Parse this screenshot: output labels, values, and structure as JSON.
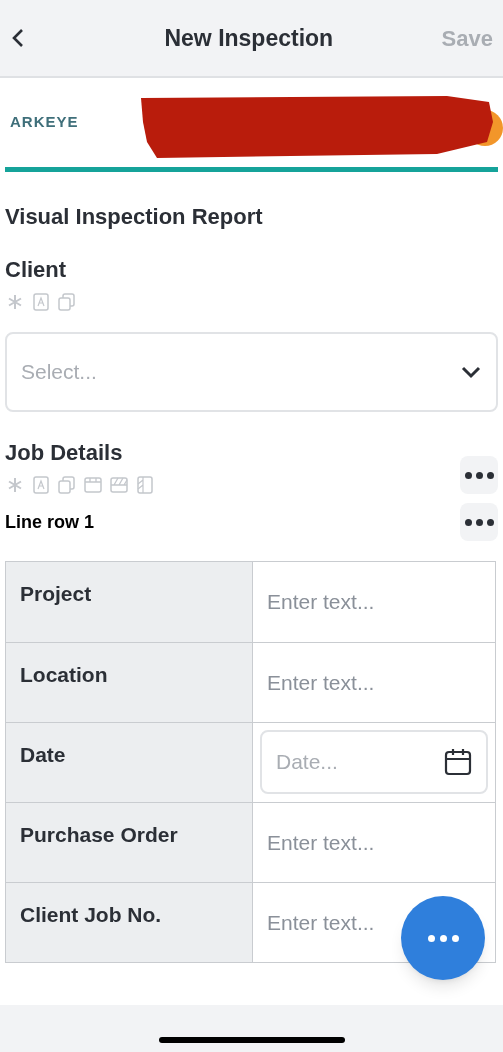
{
  "header": {
    "title": "New Inspection",
    "save": "Save",
    "save_disabled": true
  },
  "logo": {
    "text": "ARKEYE"
  },
  "form_title": "Visual Inspection Report",
  "client": {
    "label": "Client",
    "placeholder": "Select..."
  },
  "job_details": {
    "label": "Job Details",
    "row_label": "Line row 1",
    "rows": [
      {
        "label": "Project",
        "kind": "text",
        "placeholder": "Enter text..."
      },
      {
        "label": "Location",
        "kind": "text",
        "placeholder": "Enter text..."
      },
      {
        "label": "Date",
        "kind": "date",
        "placeholder": "Date..."
      },
      {
        "label": "Purchase Order",
        "kind": "text",
        "placeholder": "Enter text..."
      },
      {
        "label": "Client Job No.",
        "kind": "text",
        "placeholder": "Enter text..."
      }
    ]
  }
}
